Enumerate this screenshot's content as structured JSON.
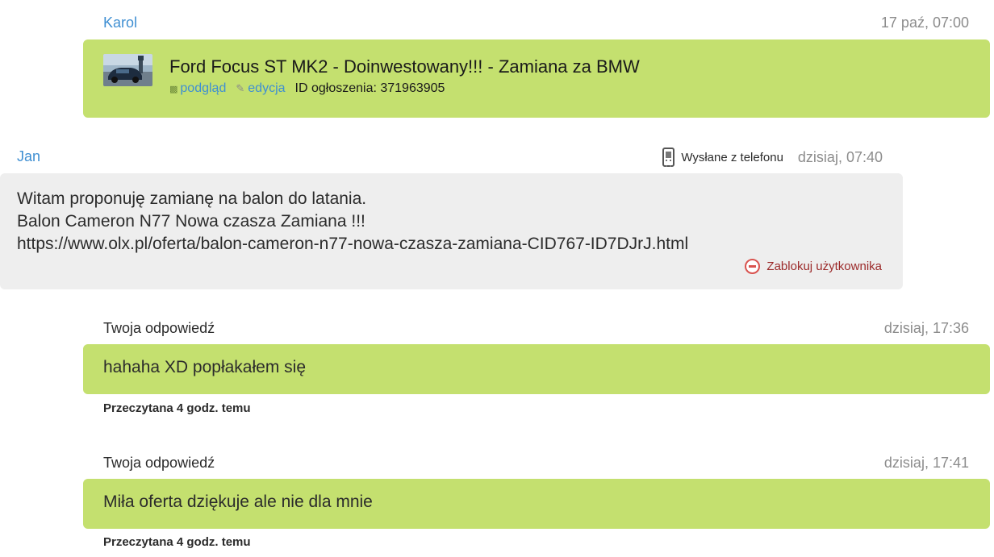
{
  "messages": [
    {
      "sender": "Karol",
      "time": "17 paź, 07:00",
      "ad": {
        "title": "Ford Focus ST MK2 - Doinwestowany!!! - Zamiana za BMW",
        "preview_label": "podgląd",
        "edit_label": "edycja",
        "id_label": "ID ogłoszenia: 371963905"
      }
    },
    {
      "sender": "Jan",
      "sent_from": "Wysłane z telefonu",
      "time": "dzisiaj, 07:40",
      "text": "Witam proponuję zamianę na balon do latania.\nBalon Cameron N77 Nowa czasza Zamiana !!!\nhttps://www.olx.pl/oferta/balon-cameron-n77-nowa-czasza-zamiana-CID767-ID7DJrJ.html",
      "block_label": "Zablokuj użytkownika"
    }
  ],
  "replies": [
    {
      "label": "Twoja odpowiedź",
      "time": "dzisiaj, 17:36",
      "text": "hahaha XD popłakałem się",
      "read_status": "Przeczytana 4 godz. temu"
    },
    {
      "label": "Twoja odpowiedź",
      "time": "dzisiaj, 17:41",
      "text": "Miła oferta dziękuje ale nie dla mnie",
      "read_status": "Przeczytana 4 godz. temu"
    }
  ],
  "colors": {
    "accent_link": "#3f8fd2",
    "own_message_bg": "#c4e06f",
    "other_message_bg": "#eeeeee",
    "block_red": "#9b2a2a"
  }
}
